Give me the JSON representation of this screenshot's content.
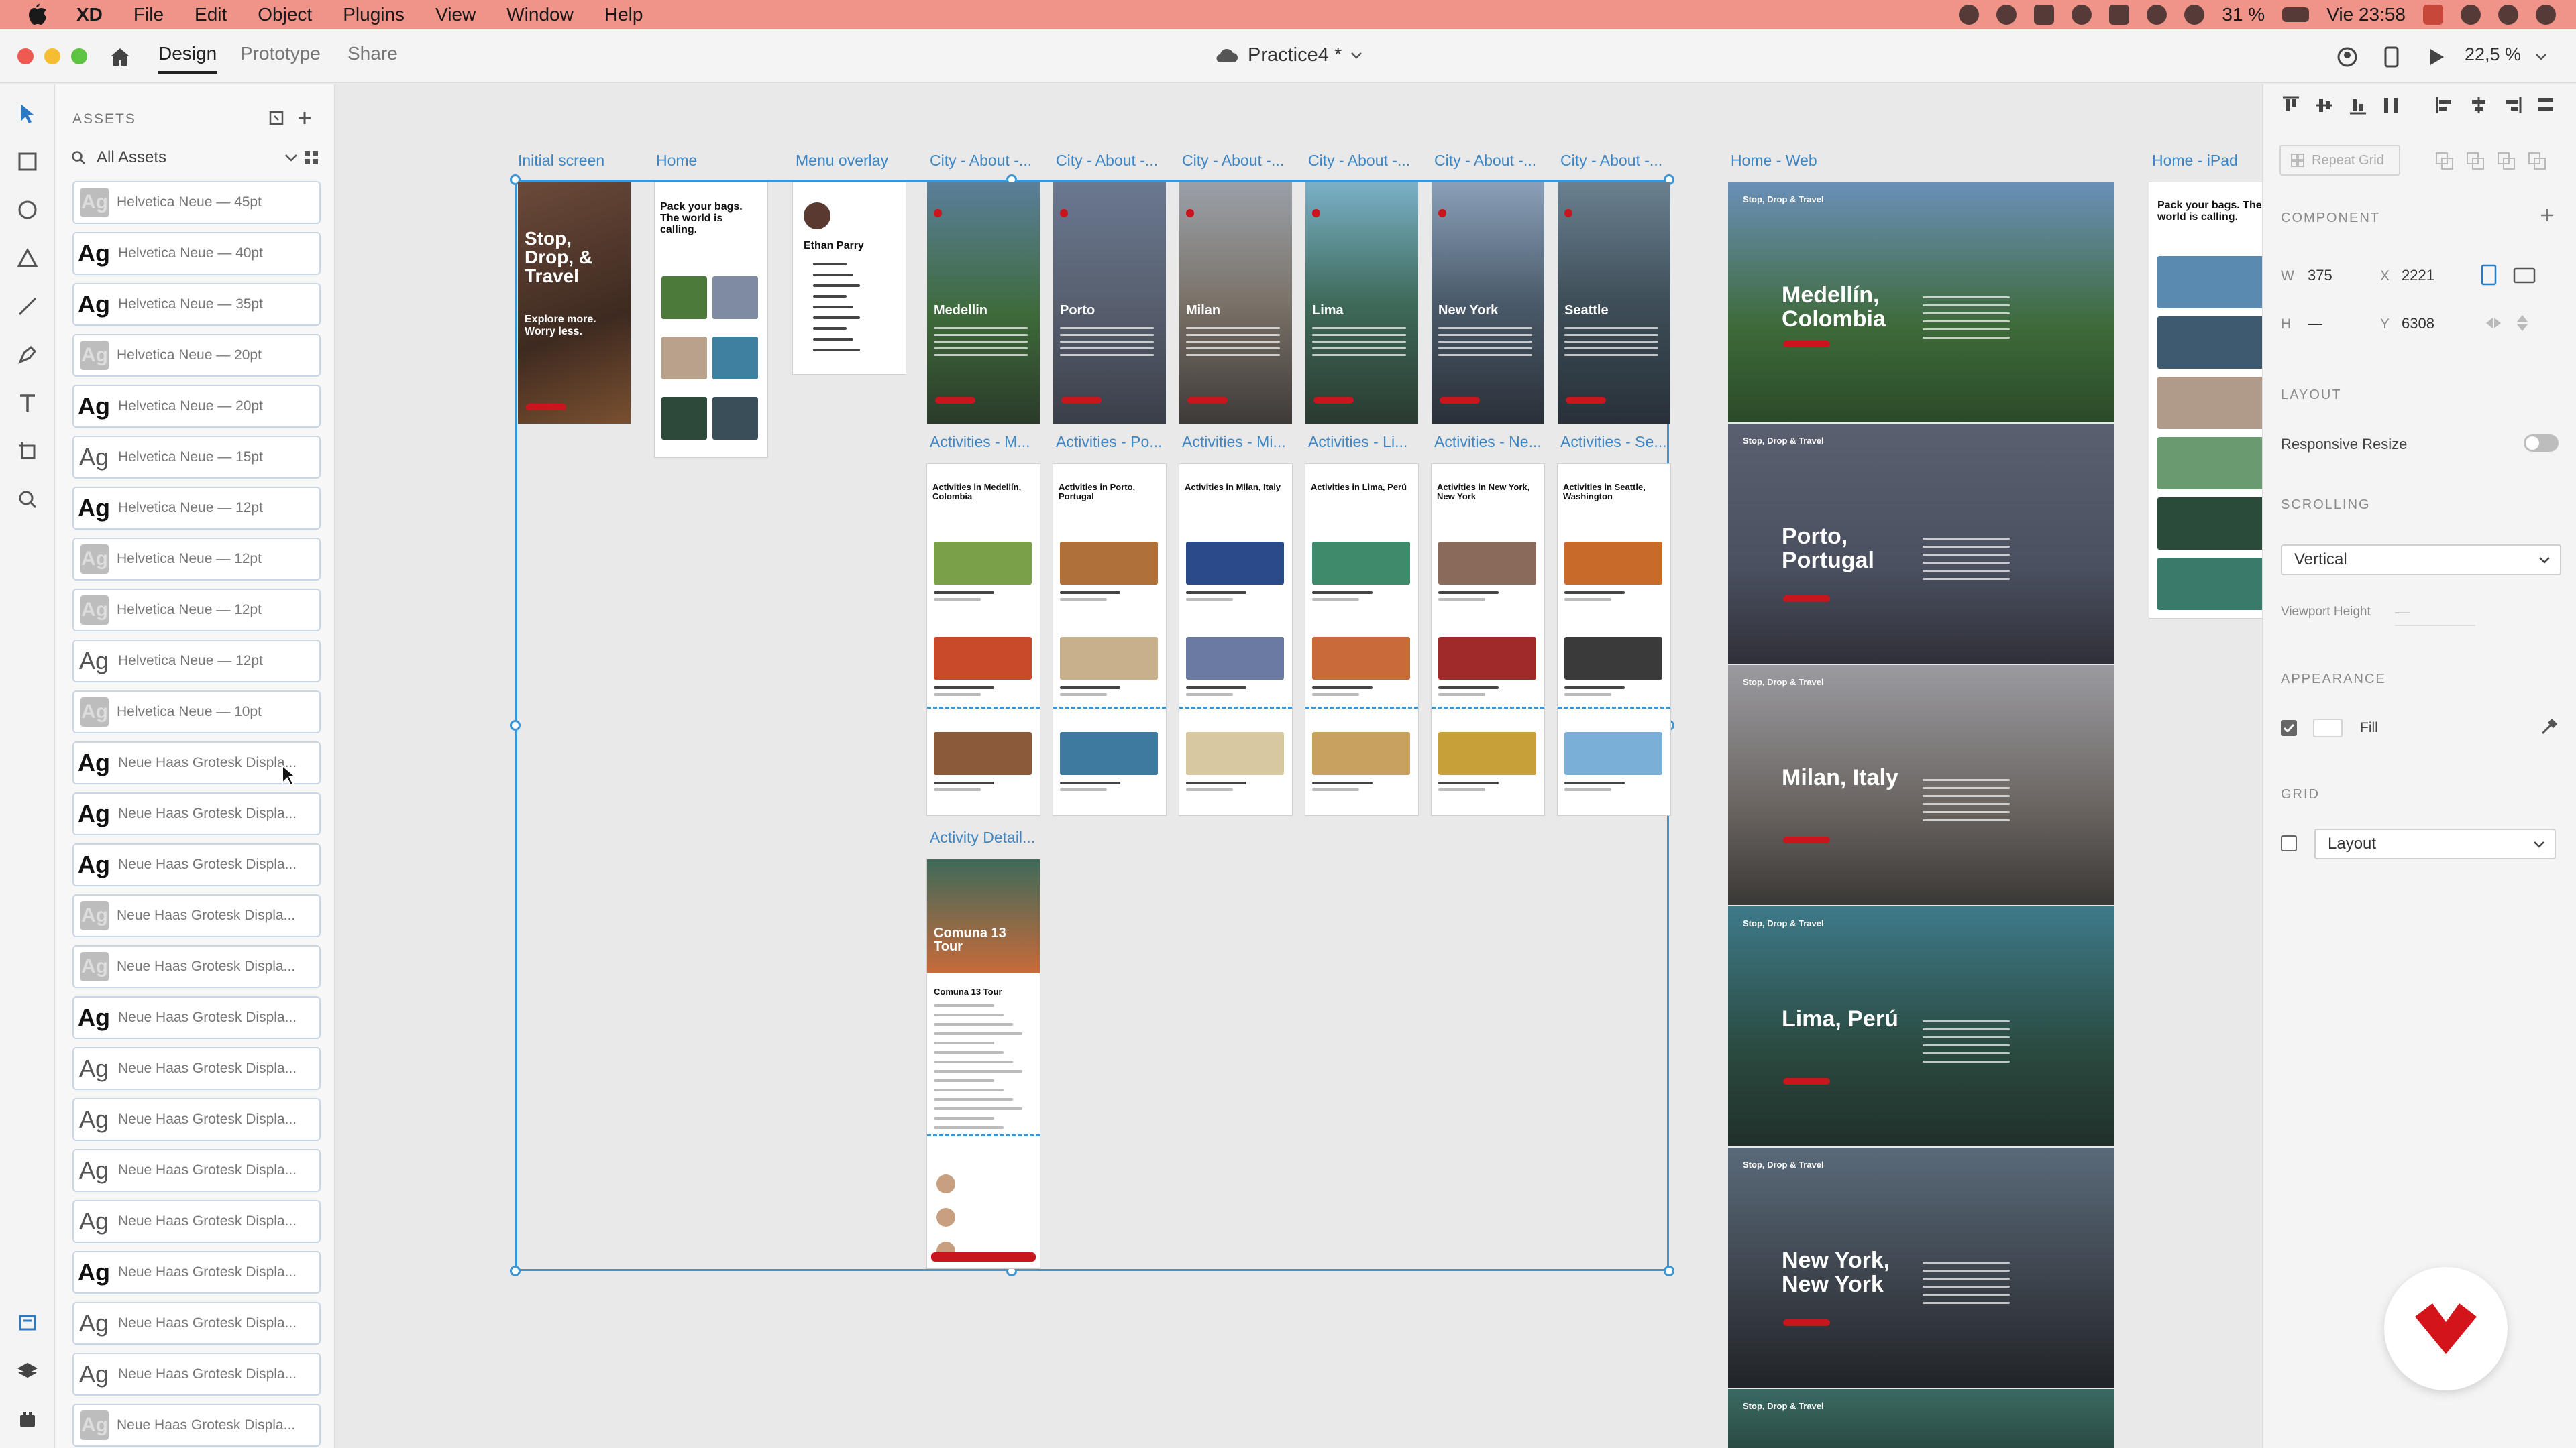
{
  "menubar": {
    "app": "XD",
    "items": [
      "File",
      "Edit",
      "Object",
      "Plugins",
      "View",
      "Window",
      "Help"
    ],
    "battery": "31 %",
    "datetime": "Vie 23:58"
  },
  "titlebar": {
    "tabs": [
      "Design",
      "Prototype",
      "Share"
    ],
    "document_title": "Practice4 *",
    "zoom": "22,5 %"
  },
  "assets": {
    "header": "ASSETS",
    "filter": "All Assets",
    "items": [
      {
        "label": "Helvetica Neue — 45pt",
        "style": "light"
      },
      {
        "label": "Helvetica Neue — 40pt",
        "style": "dark"
      },
      {
        "label": "Helvetica Neue — 35pt",
        "style": "dark"
      },
      {
        "label": "Helvetica Neue — 20pt",
        "style": "light"
      },
      {
        "label": "Helvetica Neue — 20pt",
        "style": "dark"
      },
      {
        "label": "Helvetica Neue — 15pt",
        "style": "grey"
      },
      {
        "label": "Helvetica Neue — 12pt",
        "style": "dark"
      },
      {
        "label": "Helvetica Neue — 12pt",
        "style": "light"
      },
      {
        "label": "Helvetica Neue — 12pt",
        "style": "light"
      },
      {
        "label": "Helvetica Neue — 12pt",
        "style": "grey"
      },
      {
        "label": "Helvetica Neue — 10pt",
        "style": "light"
      },
      {
        "label": "Neue Haas Grotesk Displa...",
        "style": "dark"
      },
      {
        "label": "Neue Haas Grotesk Displa...",
        "style": "dark"
      },
      {
        "label": "Neue Haas Grotesk Displa...",
        "style": "dark"
      },
      {
        "label": "Neue Haas Grotesk Displa...",
        "style": "light"
      },
      {
        "label": "Neue Haas Grotesk Displa...",
        "style": "light"
      },
      {
        "label": "Neue Haas Grotesk Displa...",
        "style": "dark"
      },
      {
        "label": "Neue Haas Grotesk Displa...",
        "style": "grey"
      },
      {
        "label": "Neue Haas Grotesk Displa...",
        "style": "grey"
      },
      {
        "label": "Neue Haas Grotesk Displa...",
        "style": "grey"
      },
      {
        "label": "Neue Haas Grotesk Displa...",
        "style": "grey"
      },
      {
        "label": "Neue Haas Grotesk Displa...",
        "style": "dark"
      },
      {
        "label": "Neue Haas Grotesk Displa...",
        "style": "grey"
      },
      {
        "label": "Neue Haas Grotesk Displa...",
        "style": "grey"
      },
      {
        "label": "Neue Haas Grotesk Displa...",
        "style": "light"
      }
    ]
  },
  "canvas": {
    "artboard_labels": {
      "initial": "Initial screen",
      "home": "Home",
      "menu": "Menu overlay",
      "city": [
        "City - About -...",
        "City - About -...",
        "City - About -...",
        "City - About -...",
        "City - About -...",
        "City - About -..."
      ],
      "activities": [
        "Activities - M...",
        "Activities - Po...",
        "Activities - Mi...",
        "Activities - Li...",
        "Activities - Ne...",
        "Activities - Se..."
      ],
      "detail": "Activity Detail...",
      "home_web": "Home - Web",
      "home_ipad": "Home - iPad"
    },
    "initial_screen": {
      "headline": "Stop, Drop, & Travel",
      "tagline": "Explore more. Worry less."
    },
    "home_screen": {
      "headline": "Pack your bags. The world is calling."
    },
    "menu_overlay": {
      "name": "Ethan Parry"
    },
    "cities": [
      "Medellin",
      "Porto",
      "Milan",
      "Lima",
      "New York",
      "Seattle"
    ],
    "activities_titles": [
      "Activities in Medellín, Colombia",
      "Activities in Porto, Portugal",
      "Activities in Milan, Italy",
      "Activities in Lima, Perú",
      "Activities in New York, New York",
      "Activities in Seattle, Washington"
    ],
    "detail": {
      "title": "Comuna 13 Tour"
    },
    "web_cities": [
      "Medellín, Colombia",
      "Porto, Portugal",
      "Milan, Italy",
      "Lima, Perú",
      "New York, New York"
    ],
    "web_brand": "Stop, Drop & Travel",
    "ipad_headline": "Pack your bags. The world is calling."
  },
  "inspector": {
    "repeat_grid": "Repeat Grid",
    "component_header": "COMPONENT",
    "w_label": "W",
    "w_value": "375",
    "h_label": "H",
    "h_value": "—",
    "x_label": "X",
    "x_value": "2221",
    "y_label": "Y",
    "y_value": "6308",
    "layout_header": "LAYOUT",
    "responsive_resize": "Responsive Resize",
    "scrolling_header": "SCROLLING",
    "scrolling_value": "Vertical",
    "viewport_height": "Viewport Height",
    "viewport_value": "—",
    "appearance_header": "APPEARANCE",
    "fill_label": "Fill",
    "grid_header": "GRID",
    "grid_value": "Layout"
  },
  "colors": {
    "accent": "#3b96d6",
    "brand_red": "#c9151e",
    "menubar": "#f0948a"
  }
}
